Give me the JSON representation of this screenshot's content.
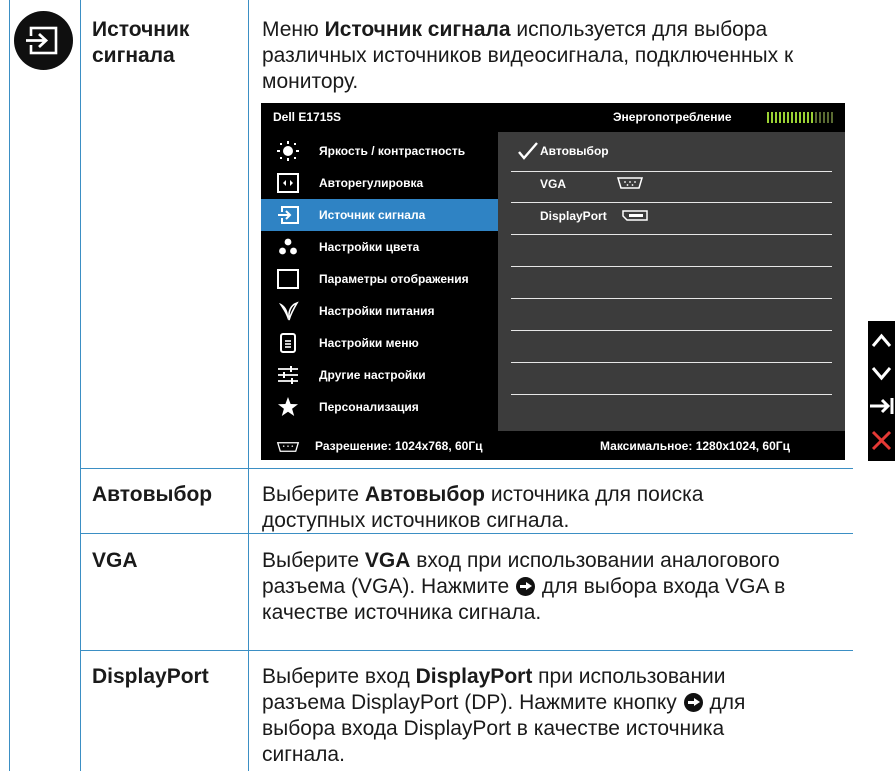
{
  "main_entry": {
    "term": [
      "Источник",
      "сигнала"
    ],
    "desc_lines": [
      [
        "Меню ",
        "Источник сигнала",
        " используется для выбора"
      ],
      "различных источников видеосигнала, подключенных к",
      "монитору."
    ]
  },
  "osd": {
    "model": "Dell E1715S",
    "energy_label": "Энергопотребление",
    "menu": [
      {
        "label": "Яркость / контрастность",
        "icon": "brightness-icon"
      },
      {
        "label": "Авторегулировка",
        "icon": "auto-adjust-icon"
      },
      {
        "label": "Источник сигнала",
        "icon": "input-source-icon",
        "active": true
      },
      {
        "label": "Настройки цвета",
        "icon": "color-dots-icon"
      },
      {
        "label": "Параметры отображения",
        "icon": "display-square-icon"
      },
      {
        "label": "Настройки питания",
        "icon": "power-leaf-icon"
      },
      {
        "label": "Настройки меню",
        "icon": "menu-doc-icon"
      },
      {
        "label": "Другие настройки",
        "icon": "sliders-icon"
      },
      {
        "label": "Персонализация",
        "icon": "star-icon"
      }
    ],
    "submenu": [
      {
        "label": "Автовыбор",
        "checked": true
      },
      {
        "label": "VGA",
        "icon": "vga-connector-icon"
      },
      {
        "label": "DisplayPort",
        "icon": "displayport-connector-icon"
      }
    ],
    "footer_resolution": "Разрешение: 1024x768, 60Гц",
    "footer_max": "Максимальное: 1280x1024, 60Гц"
  },
  "side_buttons": [
    "up-arrow-icon",
    "down-arrow-icon",
    "enter-arrow-icon",
    "close-x-icon"
  ],
  "rows": [
    {
      "term": "Автовыбор",
      "desc": [
        [
          "Выберите ",
          "Автовыбор",
          " источника для поиска"
        ],
        "доступных источников сигнала."
      ]
    },
    {
      "term": "VGA",
      "desc": [
        [
          "Выберите ",
          "VGA",
          " вход при использовании аналогового"
        ],
        [
          "разъема (VGA). Нажмите ",
          "",
          " для выбора входа VGA в"
        ],
        "качестве источника сигнала."
      ]
    },
    {
      "term": "DisplayPort",
      "desc": [
        [
          "Выберите вход ",
          "DisplayPort",
          " при использовании"
        ],
        [
          "разъема DisplayPort (DP). Нажмите кнопку ",
          "",
          " для"
        ],
        "выбора входа DisplayPort в качестве источника",
        "сигнала."
      ]
    }
  ],
  "colors": {
    "rule": "#3b8fc4",
    "osd_active": "#2f83c4",
    "energy_bar": "#9bd234",
    "close_x": "#e53935"
  }
}
